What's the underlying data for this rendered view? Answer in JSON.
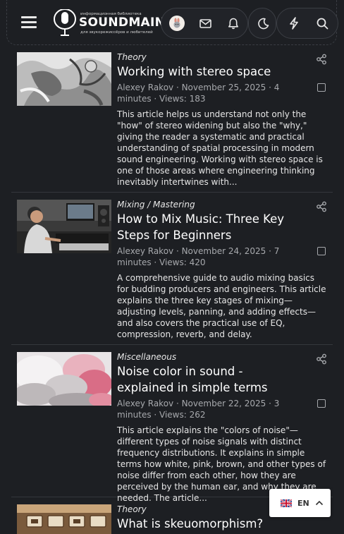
{
  "header": {
    "logo": {
      "top_text": "информационная библиотека",
      "main_text": "SOUNDMAIN",
      "bottom_text": "для звукорежиссёров и любителей"
    },
    "icons": [
      "menu-icon",
      "avatar",
      "mail-icon",
      "bell-icon",
      "moon-icon",
      "lightning-icon",
      "search-icon"
    ]
  },
  "articles": [
    {
      "category": "Theory",
      "title": "Working with stereo space",
      "meta": "Alexey Rakov · November 25, 2025 · 4 minutes · Views: 183",
      "description": "This article helps us understand not only the \"how\" of stereo widening but also the \"why,\" giving the reader a systematic and practical understanding of spatial processing in modern sound engineering. Working with stereo space is one of those areas where engineering thinking inevitably intertwines with..."
    },
    {
      "category": "Mixing / Mastering",
      "title": "How to Mix Music: Three Key Steps for Beginners",
      "meta": "Alexey Rakov · November 24, 2025 · 7 minutes · Views: 420",
      "description": "A comprehensive guide to audio mixing basics for budding producers and engineers. This article explains the three key stages of mixing—adjusting levels, panning, and adding effects—and also covers the practical use of EQ, compression, reverb, and delay."
    },
    {
      "category": "Miscellaneous",
      "title": "Noise color in sound - explained in simple terms",
      "meta": "Alexey Rakov · November 22, 2025 · 3 minutes · Views: 262",
      "description": "This article explains the \"colors of noise\"—different types of noise signals with distinct frequency distributions. It explains in simple terms how white, pink, brown, and other types of noise differ from each other, how they are perceived by the human ear, and why they are needed. The article..."
    },
    {
      "category": "Theory",
      "title": "What is skeuomorphism?",
      "meta": "",
      "description": ""
    }
  ],
  "language": {
    "code": "EN"
  },
  "colors": {
    "background": "#1d1f23",
    "divider": "#34373c",
    "text": "#e9e9ea",
    "meta": "#a7a9ad"
  }
}
